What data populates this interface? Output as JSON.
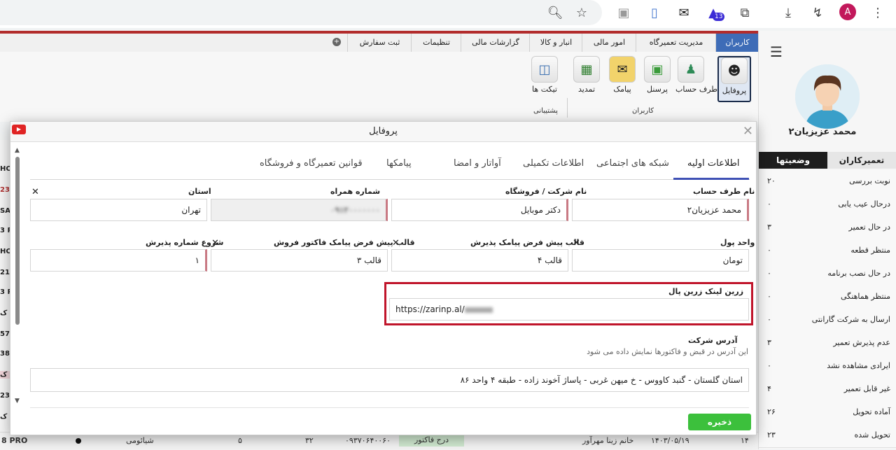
{
  "browser": {
    "ext_badge": "13",
    "profile_initial": "A"
  },
  "menu": {
    "tabs": [
      "کاربران",
      "مدیریت تعمیرگاه",
      "امور مالی",
      "انبار و کالا",
      "گزارشات مالی",
      "تنظیمات",
      "ثبت سفارش"
    ]
  },
  "ribbon": {
    "items": [
      {
        "label": "پروفایل",
        "icon": "user-icon"
      },
      {
        "label": "طرف حساب",
        "icon": "people-icon"
      },
      {
        "label": "پرسنل",
        "icon": "lock-icon"
      },
      {
        "label": "پیامک",
        "icon": "sms-icon"
      },
      {
        "label": "تمدید",
        "icon": "card-icon"
      },
      {
        "label": "تیکت ها",
        "icon": "ticket-icon"
      }
    ],
    "group_users": "کاربران",
    "group_support": "پشتیبانی"
  },
  "sidebar": {
    "user_name": "محمد عزیزیان۲",
    "tab_technicians": "تعمیرکاران",
    "tab_statuses": "وضعیتها",
    "statuses": [
      {
        "name": "نوبت بررسی",
        "count": "۲۰"
      },
      {
        "name": "درحال عیب یابی",
        "count": "۰"
      },
      {
        "name": "در حال تعمیر",
        "count": "۳"
      },
      {
        "name": "منتظر قطعه",
        "count": "۰"
      },
      {
        "name": "در حال نصب برنامه",
        "count": "۰"
      },
      {
        "name": "منتظر هماهنگی",
        "count": "۰"
      },
      {
        "name": "ارسال به شرکت گارانتی",
        "count": "۰"
      },
      {
        "name": "عدم پذیرش تعمیر",
        "count": "۳"
      },
      {
        "name": "ایرادی مشاهده نشد",
        "count": "۰"
      },
      {
        "name": "غیر قابل تعمیر",
        "count": "۴"
      },
      {
        "name": "آماده تحویل",
        "count": "۲۶"
      },
      {
        "name": "تحویل شده",
        "count": "۲۳"
      }
    ]
  },
  "background_table": {
    "left_fragments": [
      "HC",
      "23",
      "SA",
      "3 P",
      "HC",
      "21",
      "3 P",
      "ک",
      "57",
      "38",
      "ک",
      "23",
      "ک",
      "PRO"
    ],
    "bottom_row": {
      "col1": "۱۴",
      "date": "۱۴۰۳/۰۵/۱۹",
      "customer": "خانم زینا مهرآور",
      "invoice_btn": "درج فاکتور",
      "phone": "۰۹۳۷۰۶۴۰۰۶۰",
      "num1": "۳۲",
      "num2": "۵",
      "brand": "شیائومی",
      "model": "8 PRO"
    }
  },
  "modal": {
    "title": "پروفایل",
    "tabs": [
      "اطلاعات اولیه",
      "شبکه های اجتماعی",
      "اطلاعات تکمیلی",
      "آواتار و امضا",
      "پیامکها",
      "قوانین تعمیرگاه و فروشگاه"
    ],
    "fields": {
      "account_name": {
        "label": "نام طرف حساب",
        "value": "محمد عزیزیان۲"
      },
      "company_name": {
        "label": "نام شرکت / فروشگاه",
        "value": "دکتر موبایل"
      },
      "mobile": {
        "label": "شماره همراه",
        "value": "۰۹۱۲۰۰۰۰۰۰۰"
      },
      "province": {
        "label": "استان",
        "value": "تهران"
      },
      "currency": {
        "label": "واحد پول",
        "value": "تومان"
      },
      "sms_receipt_template": {
        "label": "قالب پیش فرض پیامک پذیرش",
        "value": "قالب ۴"
      },
      "sms_invoice_template": {
        "label": "قالب پیش فرض پیامک فاکتور فروش",
        "value": "قالب ۳"
      },
      "receipt_start": {
        "label": "شروع شماره پذیرش",
        "value": "۱"
      },
      "zarinpal": {
        "label": "زرین لینک زرین پال",
        "value": "https://zarinp.al/"
      },
      "address": {
        "label": "آدرس شرکت",
        "hint": "این آدرس در قبض و فاکتورها نمایش داده می شود",
        "value": "استان گلستان - گنبد کاووس - خ میهن غربی - پاساژ آخوند زاده - طبقه ۴ واحد ۸۶"
      }
    },
    "save_label": "ذخیره"
  }
}
